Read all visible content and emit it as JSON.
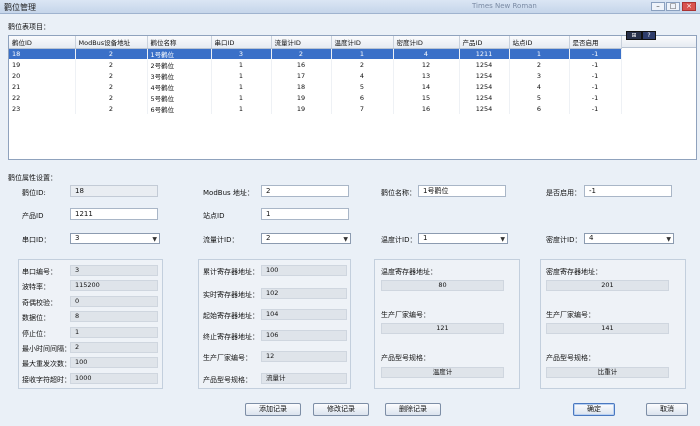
{
  "window": {
    "title": "鹳位管理",
    "bg_text": "Times New Roman"
  },
  "list": {
    "label": "鹳位表项目：",
    "columns": [
      "鹳位ID",
      "ModBus设备地址",
      "鹳位名称",
      "串口ID",
      "流量计ID",
      "温度计ID",
      "密度计ID",
      "产品ID",
      "站点ID",
      "是否启用"
    ],
    "rows": [
      [
        "18",
        "2",
        "1号鹳位",
        "3",
        "2",
        "1",
        "4",
        "1211",
        "1",
        "-1"
      ],
      [
        "19",
        "2",
        "2号鹳位",
        "1",
        "16",
        "2",
        "12",
        "1254",
        "2",
        "-1"
      ],
      [
        "20",
        "2",
        "3号鹳位",
        "1",
        "17",
        "4",
        "13",
        "1254",
        "3",
        "-1"
      ],
      [
        "21",
        "2",
        "4号鹳位",
        "1",
        "18",
        "5",
        "14",
        "1254",
        "4",
        "-1"
      ],
      [
        "22",
        "2",
        "5号鹳位",
        "1",
        "19",
        "6",
        "15",
        "1254",
        "5",
        "-1"
      ],
      [
        "23",
        "2",
        "6号鹳位",
        "1",
        "19",
        "7",
        "16",
        "1254",
        "6",
        "-1"
      ]
    ],
    "selected_row": 0
  },
  "props": {
    "label": "鹳位属性设置：",
    "crane_id_label": "鹳位ID:",
    "crane_id": "18",
    "modbus_label": "ModBus 地址：",
    "modbus": "2",
    "name_label": "鹳位名称：",
    "name": "1号鹳位",
    "enabled_label": "是否启用：",
    "enabled": "-1",
    "product_label": "产品ID",
    "product": "1211",
    "station_label": "站点ID",
    "station": "1",
    "serial_label": "串口ID：",
    "serial": "3",
    "flow_label": "流量计ID：",
    "flow": "2",
    "temp_label": "温度计ID：",
    "temp": "1",
    "density_label": "密度计ID：",
    "density": "4"
  },
  "serial_panel": {
    "items": [
      {
        "label": "串口编号：",
        "value": "3"
      },
      {
        "label": "波特率：",
        "value": "115200"
      },
      {
        "label": "奇偶校验：",
        "value": "0"
      },
      {
        "label": "数据位：",
        "value": "8"
      },
      {
        "label": "停止位：",
        "value": "1"
      },
      {
        "label": "最小时间间隔：",
        "value": "2"
      },
      {
        "label": "最大重发次数：",
        "value": "100"
      },
      {
        "label": "接收字符超时：",
        "value": "1000"
      }
    ]
  },
  "flow_panel": {
    "items": [
      {
        "label": "累计寄存器地址：",
        "value": "100"
      },
      {
        "label": "实时寄存器地址：",
        "value": "102"
      },
      {
        "label": "起始寄存器地址：",
        "value": "104"
      },
      {
        "label": "终止寄存器地址：",
        "value": "106"
      },
      {
        "label": "生产厂家编号：",
        "value": "12"
      },
      {
        "label": "产品型号规格：",
        "value": "流量计"
      }
    ]
  },
  "temp_panel": {
    "reg_label": "温度寄存器地址：",
    "reg": "80",
    "maker_label": "生产厂家编号：",
    "maker": "121",
    "model_label": "产品型号规格：",
    "model": "温度计"
  },
  "density_panel": {
    "reg_label": "密度寄存器地址：",
    "reg": "201",
    "maker_label": "生产厂家编号：",
    "maker": "141",
    "model_label": "产品型号规格：",
    "model": "比重计"
  },
  "buttons": {
    "add": "添加记录",
    "edit": "修改记录",
    "delete": "删除记录",
    "ok": "确定",
    "cancel": "取消"
  }
}
